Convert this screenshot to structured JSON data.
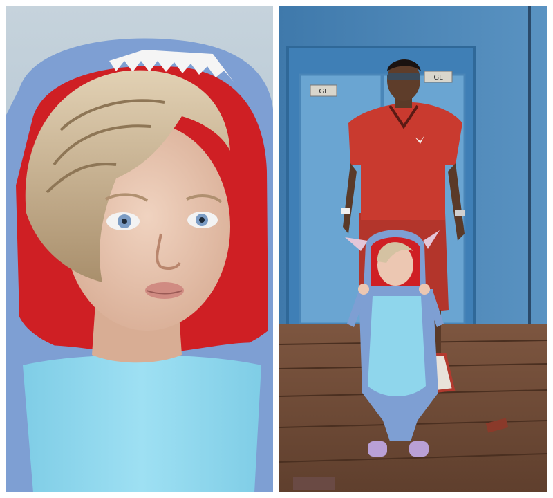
{
  "collage": {
    "panels": [
      {
        "id": "left",
        "label": ""
      },
      {
        "id": "right",
        "label": ""
      }
    ],
    "colors": {
      "frame": "#ffffff",
      "sky": "#a9bfcf",
      "hood_outer": "#7e9fd3",
      "hood_inner": "#cf1f24",
      "onesie_belly": "#8fd6ec",
      "hair": "#c9b593",
      "skin": "#e8c7b2",
      "wall": "#4f88b9",
      "door": "#6aa5d2",
      "floor": "#6e4a35",
      "shirt": "#c93a2f"
    },
    "signs": [
      "GL",
      "GL"
    ]
  }
}
